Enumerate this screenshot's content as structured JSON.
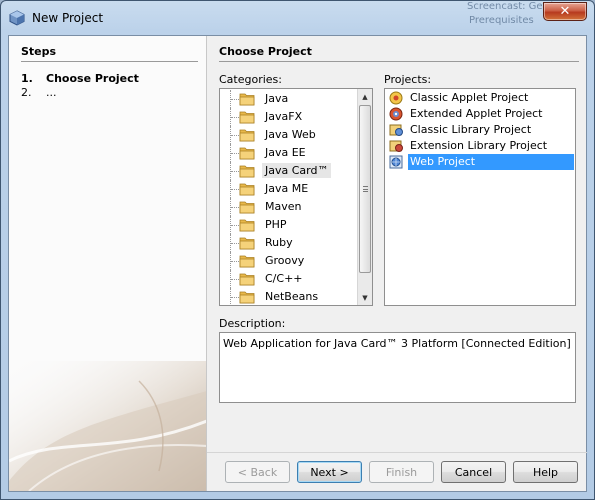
{
  "window": {
    "title": "New Project",
    "close_glyph": "✕",
    "background_text": [
      "Screencast: Getting sta",
      "Prerequisites"
    ]
  },
  "steps": {
    "title": "Steps",
    "items": [
      {
        "num": "1.",
        "label": "Choose Project",
        "active": true
      },
      {
        "num": "2.",
        "label": "...",
        "active": false
      }
    ]
  },
  "main": {
    "heading": "Choose Project",
    "categories_label": "Categories:",
    "projects_label": "Projects:",
    "categories": [
      "Java",
      "JavaFX",
      "Java Web",
      "Java EE",
      "Java Card™",
      "Java ME",
      "Maven",
      "PHP",
      "Ruby",
      "Groovy",
      "C/C++",
      "NetBeans Modules"
    ],
    "highlighted_category": "Java Card™",
    "projects": [
      {
        "label": "Classic Applet Project",
        "icon": "applet-icon"
      },
      {
        "label": "Extended Applet Project",
        "icon": "extended-applet-icon"
      },
      {
        "label": "Classic Library Project",
        "icon": "library-icon"
      },
      {
        "label": "Extension Library Project",
        "icon": "extension-library-icon"
      },
      {
        "label": "Web Project",
        "icon": "web-project-icon"
      }
    ],
    "selected_project": "Web Project",
    "description_label": "Description:",
    "description_text": "Web Application for Java Card™ 3 Platform [Connected Edition]"
  },
  "buttons": {
    "back": "< Back",
    "next": "Next >",
    "finish": "Finish",
    "cancel": "Cancel",
    "help": "Help"
  },
  "colors": {
    "selection": "#3399ff",
    "folder": "#e8b84a",
    "title_bar": "#bcd2ea",
    "close_button": "#c0442a"
  }
}
